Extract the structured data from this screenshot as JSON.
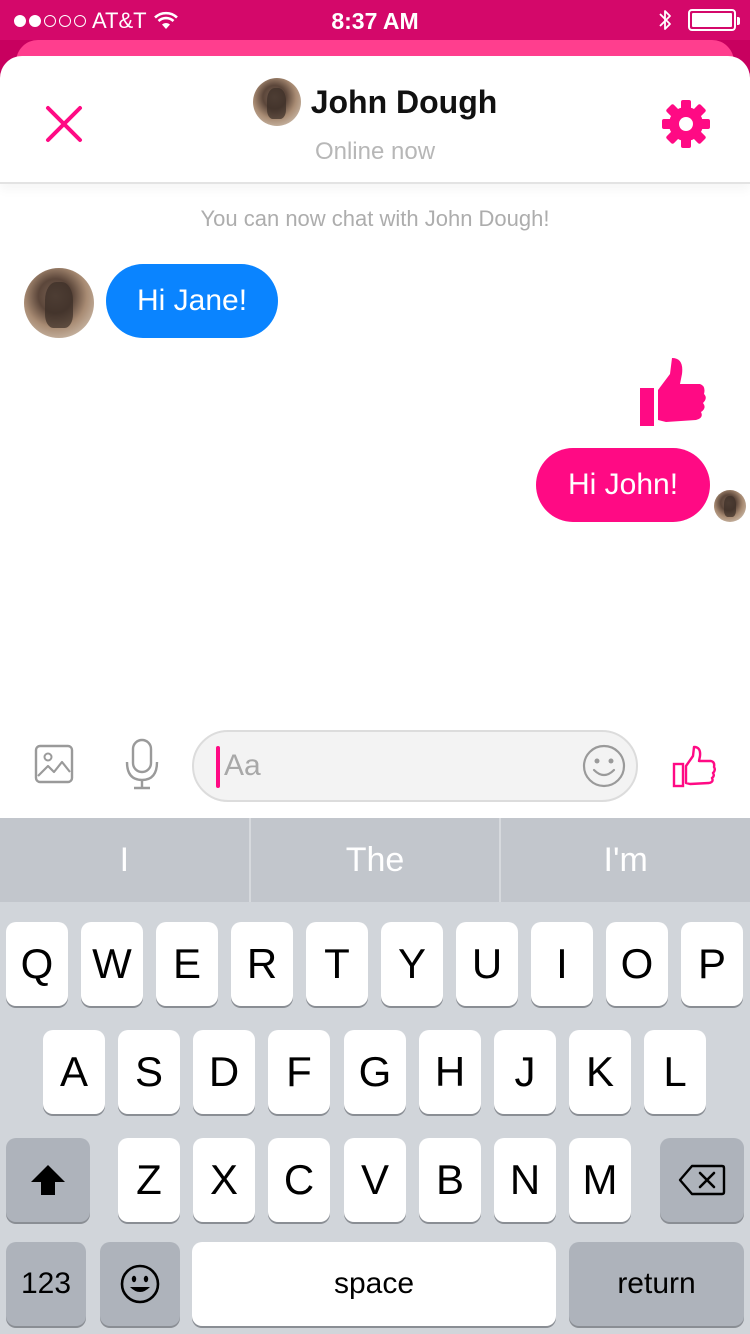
{
  "status_bar": {
    "carrier": "AT&T",
    "signal_dots_filled": 2,
    "signal_dots_total": 5,
    "time": "8:37 AM",
    "battery_level": 1.0
  },
  "header": {
    "contact_name": "John Dough",
    "status": "Online now",
    "accent_color": "#ff0a84"
  },
  "chat": {
    "system_message": "You can now chat with John Dough!",
    "messages": [
      {
        "from": "contact",
        "text": "Hi Jane!",
        "color": "#0a84ff"
      },
      {
        "from": "me",
        "type": "like-sticker"
      },
      {
        "from": "me",
        "text": "Hi John!",
        "color": "#ff0a84"
      }
    ]
  },
  "composer": {
    "placeholder": "Aa",
    "icons": [
      "photo-icon",
      "microphone-icon",
      "emoji-icon",
      "thumbs-up-icon"
    ]
  },
  "keyboard": {
    "suggestions": [
      "I",
      "The",
      "I'm"
    ],
    "row1": [
      "Q",
      "W",
      "E",
      "R",
      "T",
      "Y",
      "U",
      "I",
      "O",
      "P"
    ],
    "row2": [
      "A",
      "S",
      "D",
      "F",
      "G",
      "H",
      "J",
      "K",
      "L"
    ],
    "row3": [
      "Z",
      "X",
      "C",
      "V",
      "B",
      "N",
      "M"
    ],
    "numbers_label": "123",
    "space_label": "space",
    "return_label": "return"
  }
}
